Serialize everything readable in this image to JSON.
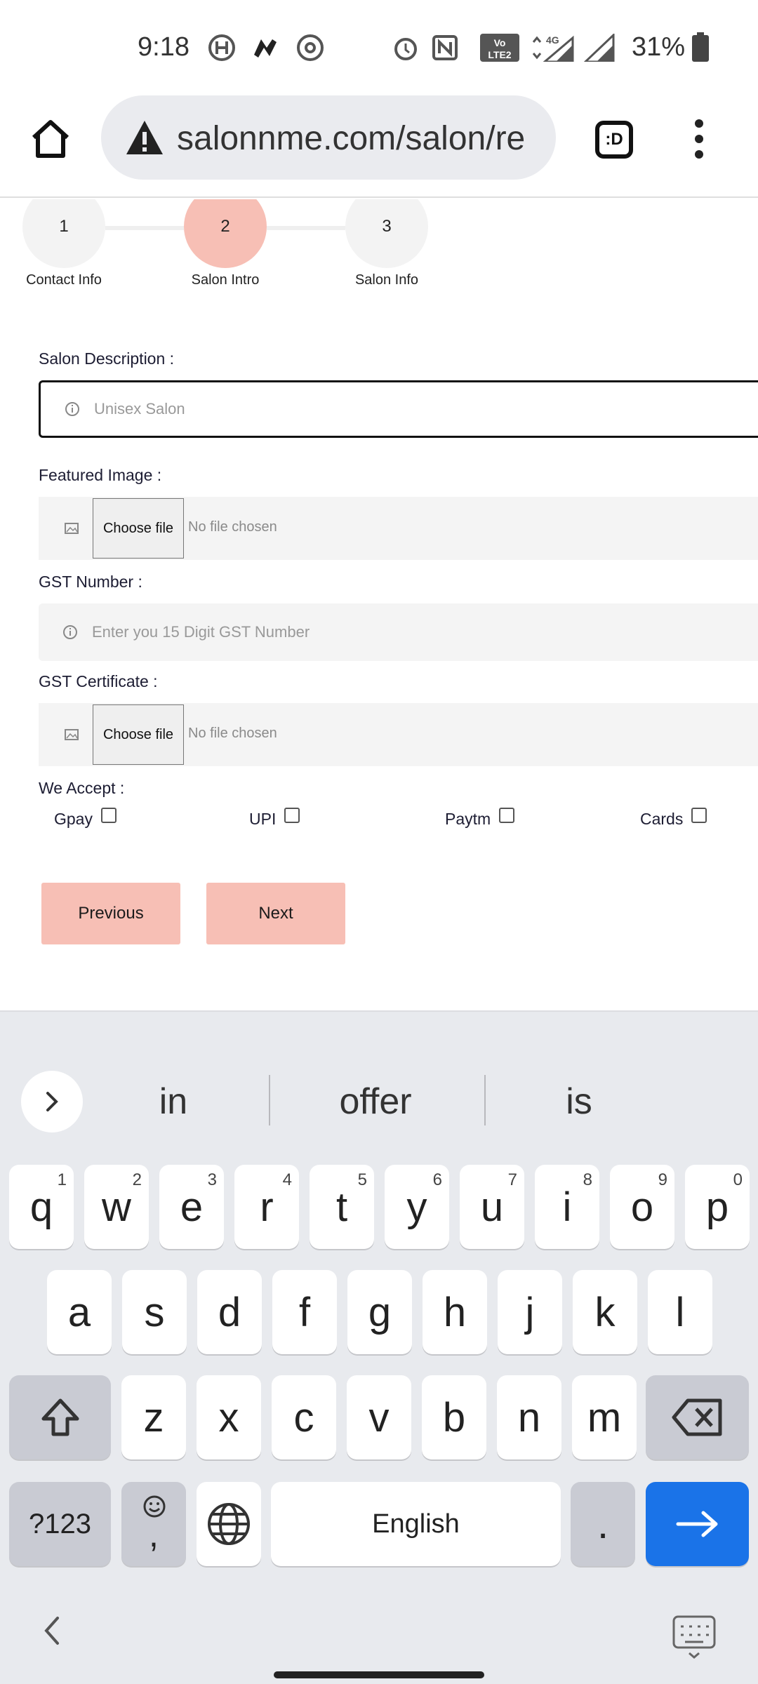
{
  "status_bar": {
    "time": "9:18",
    "battery_percent": "31%",
    "icons": [
      "hotstar-icon",
      "app-icon",
      "chrome-icon",
      "alarm-icon",
      "nfc-icon",
      "volte-icon",
      "signal-4g-icon",
      "signal-icon",
      "battery-icon"
    ]
  },
  "browser": {
    "url": "salonnme.com/salon/re",
    "tabs_label": ":D"
  },
  "stepper": {
    "steps": [
      {
        "number": "1",
        "label": "Contact Info"
      },
      {
        "number": "2",
        "label": "Salon Intro"
      },
      {
        "number": "3",
        "label": "Salon Info"
      }
    ],
    "active_index": 1
  },
  "form": {
    "salon_description": {
      "label": "Salon Description :",
      "placeholder": "Unisex Salon"
    },
    "featured_image": {
      "label": "Featured Image :",
      "button": "Choose file",
      "status": "No file chosen"
    },
    "gst_number": {
      "label": "GST Number :",
      "placeholder": "Enter you 15 Digit GST Number"
    },
    "gst_certificate": {
      "label": "GST Certificate :",
      "button": "Choose file",
      "status": "No file chosen"
    },
    "we_accept": {
      "label": "We Accept :",
      "options": [
        "Gpay",
        "UPI",
        "Paytm",
        "Cards"
      ]
    },
    "previous_label": "Previous",
    "next_label": "Next"
  },
  "keyboard": {
    "suggestions": [
      "in",
      "offer",
      "is"
    ],
    "row1": [
      {
        "key": "q",
        "hint": "1"
      },
      {
        "key": "w",
        "hint": "2"
      },
      {
        "key": "e",
        "hint": "3"
      },
      {
        "key": "r",
        "hint": "4"
      },
      {
        "key": "t",
        "hint": "5"
      },
      {
        "key": "y",
        "hint": "6"
      },
      {
        "key": "u",
        "hint": "7"
      },
      {
        "key": "i",
        "hint": "8"
      },
      {
        "key": "o",
        "hint": "9"
      },
      {
        "key": "p",
        "hint": "0"
      }
    ],
    "row2": [
      "a",
      "s",
      "d",
      "f",
      "g",
      "h",
      "j",
      "k",
      "l"
    ],
    "row3": [
      "z",
      "x",
      "c",
      "v",
      "b",
      "n",
      "m"
    ],
    "symbols_key": "?123",
    "emoji_comma_key": ",",
    "space_label": "English",
    "period_key": "."
  }
}
